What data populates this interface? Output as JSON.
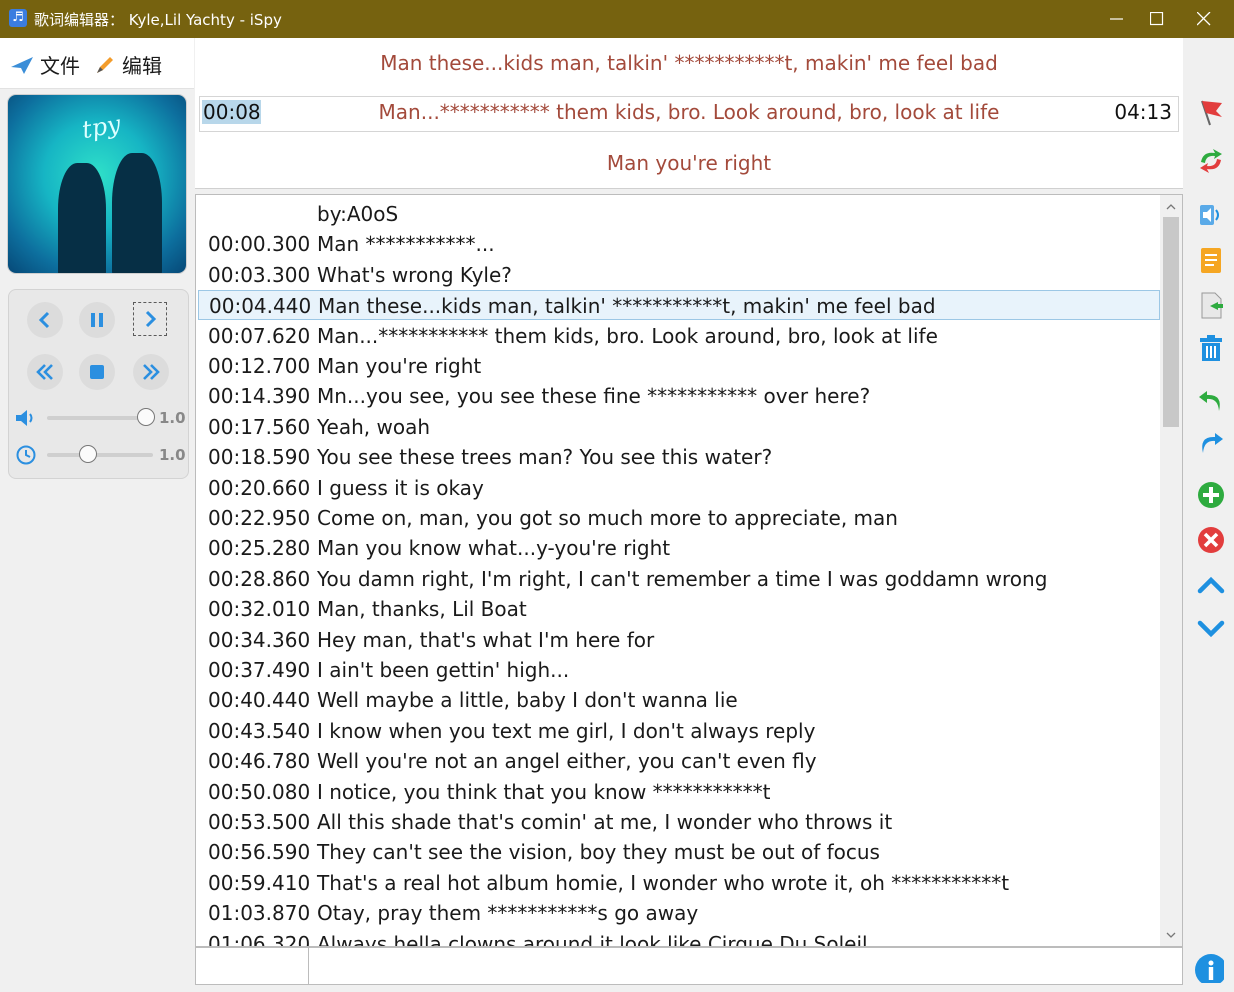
{
  "window": {
    "title": "歌词编辑器： Kyle,Lil Yachty - iSpy"
  },
  "menu": {
    "file_label": "文件",
    "edit_label": "编辑"
  },
  "album": {
    "scribble": "tpy"
  },
  "player": {
    "volume_value": "1.0",
    "speed_value": "1.0",
    "volume_level": 1.0,
    "speed_level": 0.35
  },
  "preview": {
    "prev_line": "Man these...kids man, talkin' ***********t, makin' me feel bad",
    "current_line": "Man...*********** them kids, bro. Look around, bro, look at life",
    "next_line": "Man you're right",
    "current_time": "00:08",
    "total_time": "04:13"
  },
  "lyrics": [
    {
      "time": "",
      "text": "by:A0oS"
    },
    {
      "time": "00:00.300",
      "text": "Man ***********..."
    },
    {
      "time": "00:03.300",
      "text": "What's wrong Kyle?"
    },
    {
      "time": "00:04.440",
      "text": "Man these...kids man, talkin' ***********t, makin' me feel bad",
      "selected": true
    },
    {
      "time": "00:07.620",
      "text": "Man...*********** them kids, bro. Look around, bro, look at life"
    },
    {
      "time": "00:12.700",
      "text": "Man you're right"
    },
    {
      "time": "00:14.390",
      "text": "Mn...you see, you see these fine *********** over here?"
    },
    {
      "time": "00:17.560",
      "text": "Yeah, woah"
    },
    {
      "time": "00:18.590",
      "text": "You see these trees man? You see this water?"
    },
    {
      "time": "00:20.660",
      "text": "I guess it is okay"
    },
    {
      "time": "00:22.950",
      "text": "Come on, man, you got so much more to appreciate, man"
    },
    {
      "time": "00:25.280",
      "text": "Man you know what...y-you're right"
    },
    {
      "time": "00:28.860",
      "text": "You damn right, I'm right, I can't remember a time I was goddamn wrong"
    },
    {
      "time": "00:32.010",
      "text": "Man, thanks, Lil Boat"
    },
    {
      "time": "00:34.360",
      "text": "Hey man, that's what I'm here for"
    },
    {
      "time": "00:37.490",
      "text": "I ain't been gettin' high..."
    },
    {
      "time": "00:40.440",
      "text": "Well maybe a little, baby I don't wanna lie"
    },
    {
      "time": "00:43.540",
      "text": "I know when you text me girl, I don't always reply"
    },
    {
      "time": "00:46.780",
      "text": "Well you're not an angel either, you can't even fly"
    },
    {
      "time": "00:50.080",
      "text": "I notice, you think that you know ***********t"
    },
    {
      "time": "00:53.500",
      "text": "All this shade that's comin' at me, I wonder who throws it"
    },
    {
      "time": "00:56.590",
      "text": "They can't see the vision, boy they must be out of focus"
    },
    {
      "time": "00:59.410",
      "text": "That's a real hot album homie, I wonder who wrote it, oh ***********t"
    },
    {
      "time": "01:03.870",
      "text": "Otay, pray them ***********s go away"
    },
    {
      "time": "01:06.320",
      "text": "Always hella clowns around it look like Cirque Du Soleil"
    }
  ],
  "colors": {
    "titlebar": "#76620f",
    "lyric_accent": "#a34a3b",
    "selection": "#e8f3fb",
    "toolbar_blue": "#1e90e0"
  },
  "icons": {
    "toolbar": [
      "flag-icon",
      "sync-icon",
      "speaker-icon",
      "document-icon",
      "import-icon",
      "trash-icon",
      "undo-icon",
      "redo-icon",
      "add-icon",
      "delete-icon",
      "move-up-icon",
      "move-down-icon",
      "info-icon"
    ]
  }
}
